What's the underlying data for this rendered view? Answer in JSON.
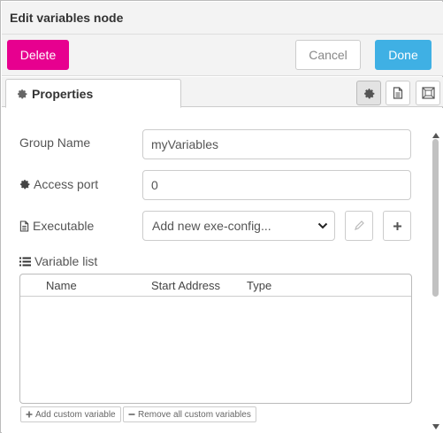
{
  "title": "Edit variables node",
  "toolbar": {
    "delete_label": "Delete",
    "cancel_label": "Cancel",
    "done_label": "Done"
  },
  "tabs": {
    "properties_label": "Properties",
    "icons": [
      "gear-icon",
      "document-icon",
      "frame-icon"
    ]
  },
  "form": {
    "group_name_label": "Group Name",
    "group_name_value": "myVariables",
    "access_port_label": "Access port",
    "access_port_value": "0",
    "executable_label": "Executable",
    "executable_selected": "Add new exe-config...",
    "variable_list_label": "Variable list"
  },
  "variable_table": {
    "columns": [
      "Name",
      "Start Address",
      "Type"
    ],
    "rows": []
  },
  "actions": {
    "add_custom_variable": "Add custom variable",
    "remove_all_custom_variables": "Remove all custom variables"
  },
  "colors": {
    "delete": "#e7008f",
    "done": "#3fb0e4",
    "header_bg": "#f3f3f3"
  }
}
